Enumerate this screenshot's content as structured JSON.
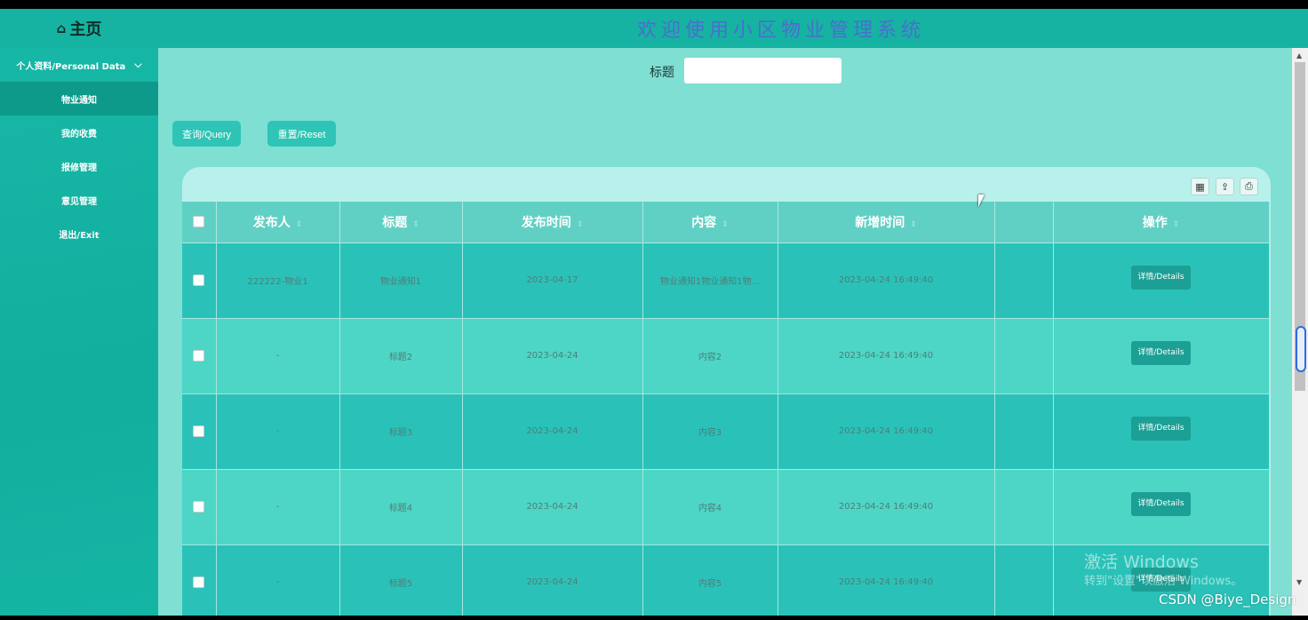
{
  "header": {
    "home_label": "主页",
    "system_title": "欢迎使用小区物业管理系统"
  },
  "sidebar": {
    "section": "个人资料/Personal Data",
    "items": [
      {
        "label": "物业通知",
        "active": true
      },
      {
        "label": "我的收费",
        "active": false
      },
      {
        "label": "报修管理",
        "active": false
      },
      {
        "label": "意见管理",
        "active": false
      },
      {
        "label": "退出/Exit",
        "active": false
      }
    ]
  },
  "search": {
    "label": "标题",
    "value": ""
  },
  "buttons": {
    "query": "查询/Query",
    "reset": "重置/Reset"
  },
  "table": {
    "columns": [
      "发布人",
      "标题",
      "发布时间",
      "内容",
      "新增时间",
      "",
      "操作"
    ],
    "rows": [
      {
        "publisher": "222222-物业1",
        "title": "物业通知1",
        "publish_date": "2023-04-17",
        "content": "物业通知1物业通知1物...",
        "added_time": "2023-04-24 16:49:40",
        "action": "详情/Details"
      },
      {
        "publisher": "-",
        "title": "标题2",
        "publish_date": "2023-04-24",
        "content": "内容2",
        "added_time": "2023-04-24 16:49:40",
        "action": "详情/Details"
      },
      {
        "publisher": "-",
        "title": "标题3",
        "publish_date": "2023-04-24",
        "content": "内容3",
        "added_time": "2023-04-24 16:49:40",
        "action": "详情/Details"
      },
      {
        "publisher": "-",
        "title": "标题4",
        "publish_date": "2023-04-24",
        "content": "内容4",
        "added_time": "2023-04-24 16:49:40",
        "action": "详情/Details"
      },
      {
        "publisher": "-",
        "title": "标题5",
        "publish_date": "2023-04-24",
        "content": "内容5",
        "added_time": "2023-04-24 16:49:40",
        "action": "详情/Details"
      }
    ]
  },
  "watermark": {
    "line1": "激活 Windows",
    "line2": "转到\"设置\"以激活 Windows。"
  },
  "credit": "CSDN @Biye_Design",
  "colors": {
    "header": "#16b3a2",
    "sidebar": "#12ae9e",
    "main_bg": "#7fdfd3",
    "table_header": "#61d0c4",
    "row_odd": "#2ac2b8",
    "row_even": "#4dd6c6",
    "button": "#2ec4b6",
    "title_text": "#4a6ed0"
  }
}
